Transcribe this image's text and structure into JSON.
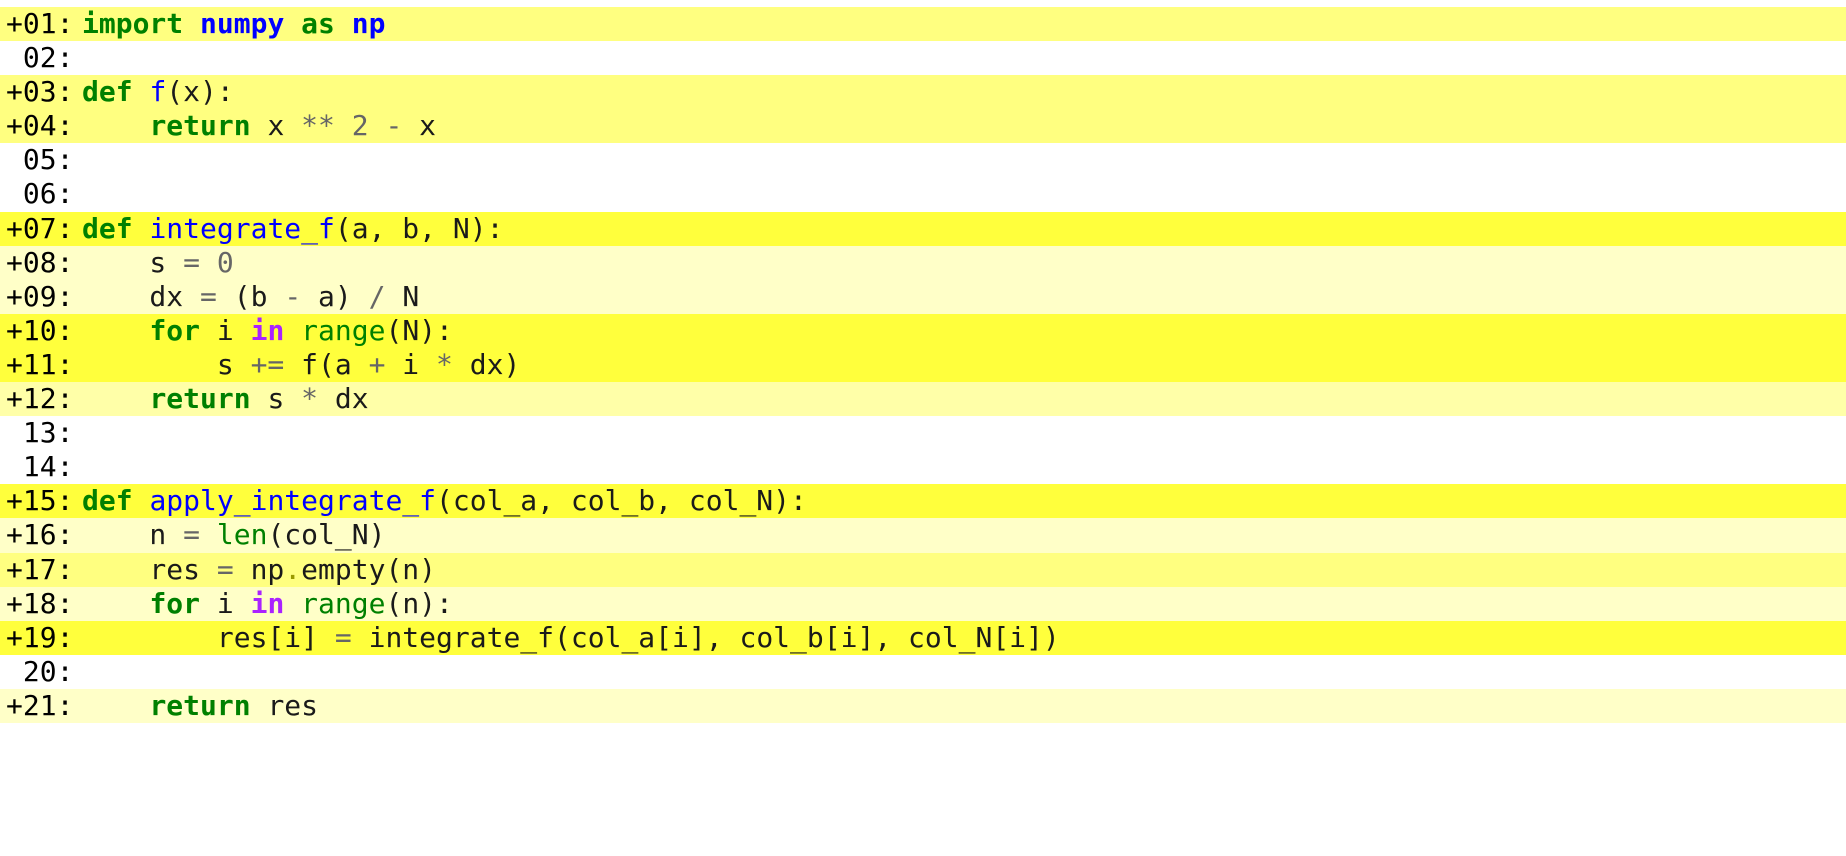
{
  "viewer": {
    "title": ""
  },
  "colors": {
    "heat_strong": "#ffff3c",
    "heat_medium": "#ffff80",
    "heat_light": "#ffffa8",
    "heat_faint": "#ffffc8",
    "keyword": "#008000",
    "function_name": "#0000ff",
    "builtin": "#008000",
    "operator": "#666666",
    "operator_word": "#aa22ff"
  },
  "lines": [
    {
      "gutter": "+01:",
      "heat": "medium",
      "tokens": [
        [
          "kw",
          "import"
        ],
        [
          "p",
          " "
        ],
        [
          "mod",
          "numpy"
        ],
        [
          "p",
          " "
        ],
        [
          "kw",
          "as"
        ],
        [
          "p",
          " "
        ],
        [
          "mod",
          "np"
        ]
      ]
    },
    {
      "gutter": " 02:",
      "heat": "none",
      "tokens": []
    },
    {
      "gutter": "+03:",
      "heat": "medium",
      "tokens": [
        [
          "kw",
          "def"
        ],
        [
          "p",
          " "
        ],
        [
          "name",
          "f"
        ],
        [
          "p",
          "(x):"
        ]
      ]
    },
    {
      "gutter": "+04:",
      "heat": "medium",
      "tokens": [
        [
          "p",
          "    "
        ],
        [
          "kw",
          "return"
        ],
        [
          "p",
          " x "
        ],
        [
          "op",
          "**"
        ],
        [
          "p",
          " "
        ],
        [
          "num",
          "2"
        ],
        [
          "p",
          " "
        ],
        [
          "op",
          "-"
        ],
        [
          "p",
          " x"
        ]
      ]
    },
    {
      "gutter": " 05:",
      "heat": "none",
      "tokens": []
    },
    {
      "gutter": " 06:",
      "heat": "none",
      "tokens": []
    },
    {
      "gutter": "+07:",
      "heat": "strong",
      "tokens": [
        [
          "kw",
          "def"
        ],
        [
          "p",
          " "
        ],
        [
          "name",
          "integrate_f"
        ],
        [
          "p",
          "(a, b, N):"
        ]
      ]
    },
    {
      "gutter": "+08:",
      "heat": "faint",
      "tokens": [
        [
          "p",
          "    s "
        ],
        [
          "op",
          "="
        ],
        [
          "p",
          " "
        ],
        [
          "num",
          "0"
        ]
      ]
    },
    {
      "gutter": "+09:",
      "heat": "faint",
      "tokens": [
        [
          "p",
          "    dx "
        ],
        [
          "op",
          "="
        ],
        [
          "p",
          " (b "
        ],
        [
          "op",
          "-"
        ],
        [
          "p",
          " a) "
        ],
        [
          "op",
          "/"
        ],
        [
          "p",
          " N"
        ]
      ]
    },
    {
      "gutter": "+10:",
      "heat": "strong",
      "tokens": [
        [
          "p",
          "    "
        ],
        [
          "kw",
          "for"
        ],
        [
          "p",
          " i "
        ],
        [
          "ow",
          "in"
        ],
        [
          "p",
          " "
        ],
        [
          "builtin",
          "range"
        ],
        [
          "p",
          "(N):"
        ]
      ]
    },
    {
      "gutter": "+11:",
      "heat": "strong",
      "tokens": [
        [
          "p",
          "        s "
        ],
        [
          "op",
          "+="
        ],
        [
          "p",
          " f(a "
        ],
        [
          "op",
          "+"
        ],
        [
          "p",
          " i "
        ],
        [
          "op",
          "*"
        ],
        [
          "p",
          " dx)"
        ]
      ]
    },
    {
      "gutter": "+12:",
      "heat": "light",
      "tokens": [
        [
          "p",
          "    "
        ],
        [
          "kw",
          "return"
        ],
        [
          "p",
          " s "
        ],
        [
          "op",
          "*"
        ],
        [
          "p",
          " dx"
        ]
      ]
    },
    {
      "gutter": " 13:",
      "heat": "none",
      "tokens": []
    },
    {
      "gutter": " 14:",
      "heat": "none",
      "tokens": []
    },
    {
      "gutter": "+15:",
      "heat": "strong",
      "tokens": [
        [
          "kw",
          "def"
        ],
        [
          "p",
          " "
        ],
        [
          "name",
          "apply_integrate_f"
        ],
        [
          "p",
          "(col_a, col_b, col_N):"
        ]
      ]
    },
    {
      "gutter": "+16:",
      "heat": "faint",
      "tokens": [
        [
          "p",
          "    n "
        ],
        [
          "op",
          "="
        ],
        [
          "p",
          " "
        ],
        [
          "builtin",
          "len"
        ],
        [
          "p",
          "(col_N)"
        ]
      ]
    },
    {
      "gutter": "+17:",
      "heat": "medium",
      "tokens": [
        [
          "p",
          "    res "
        ],
        [
          "op",
          "="
        ],
        [
          "p",
          " np"
        ],
        [
          "dot",
          "."
        ],
        [
          "p",
          "empty(n)"
        ]
      ]
    },
    {
      "gutter": "+18:",
      "heat": "faint",
      "tokens": [
        [
          "p",
          "    "
        ],
        [
          "kw",
          "for"
        ],
        [
          "p",
          " i "
        ],
        [
          "ow",
          "in"
        ],
        [
          "p",
          " "
        ],
        [
          "builtin",
          "range"
        ],
        [
          "p",
          "(n):"
        ]
      ]
    },
    {
      "gutter": "+19:",
      "heat": "strong",
      "tokens": [
        [
          "p",
          "        res[i] "
        ],
        [
          "op",
          "="
        ],
        [
          "p",
          " integrate_f(col_a[i], col_b[i], col_N[i])"
        ]
      ]
    },
    {
      "gutter": " 20:",
      "heat": "none",
      "tokens": []
    },
    {
      "gutter": "+21:",
      "heat": "faint",
      "tokens": [
        [
          "p",
          "    "
        ],
        [
          "kw",
          "return"
        ],
        [
          "p",
          " res"
        ]
      ]
    }
  ]
}
